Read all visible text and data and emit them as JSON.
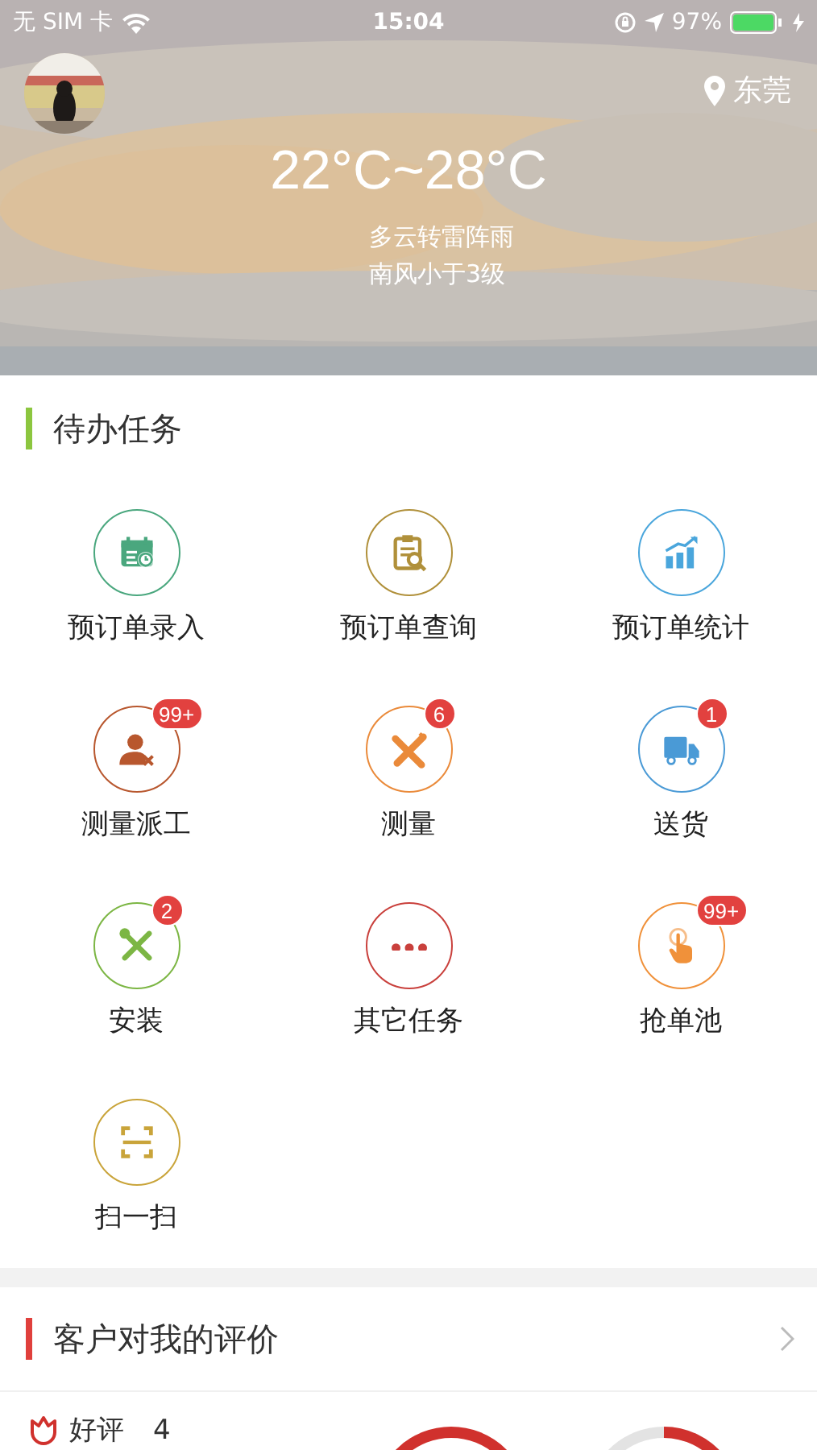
{
  "status_bar": {
    "carrier": "无 SIM 卡",
    "time": "15:04",
    "battery": "97%"
  },
  "header": {
    "location": "东莞",
    "temperature": "22°C~28°C",
    "condition": "多云转雷阵雨",
    "wind": "南风小于3级"
  },
  "tasks": {
    "title": "待办任务",
    "items": [
      {
        "label": "预订单录入",
        "kind": "calendar",
        "color": "#4aa77e"
      },
      {
        "label": "预订单查询",
        "kind": "clipboard",
        "color": "#b0903a"
      },
      {
        "label": "预订单统计",
        "kind": "chart",
        "color": "#4aa6dc"
      },
      {
        "label": "测量派工",
        "kind": "worker",
        "color": "#b8572e",
        "badge": "99+"
      },
      {
        "label": "测量",
        "kind": "ruler",
        "color": "#ea8a3a",
        "badge": "6"
      },
      {
        "label": "送货",
        "kind": "truck",
        "color": "#4a9ad6",
        "badge": "1"
      },
      {
        "label": "安装",
        "kind": "tools",
        "color": "#7cb644",
        "badge": "2"
      },
      {
        "label": "其它任务",
        "kind": "more",
        "color": "#c9403c"
      },
      {
        "label": "抢单池",
        "kind": "hand",
        "color": "#f0913a",
        "badge": "99+"
      },
      {
        "label": "扫一扫",
        "kind": "scan",
        "color": "#c9a43a"
      }
    ]
  },
  "reviews": {
    "title": "客户对我的评价",
    "rows": [
      {
        "label": "好评",
        "count": "4"
      }
    ]
  }
}
